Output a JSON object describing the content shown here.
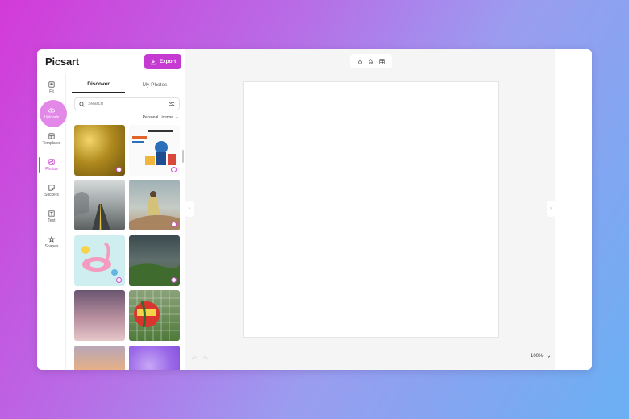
{
  "app": {
    "logo": "Picsart"
  },
  "header": {
    "export_label": "Export"
  },
  "rail": {
    "items": [
      {
        "label": "Fit",
        "icon": "fit-icon"
      },
      {
        "label": "Uploads",
        "icon": "upload-icon"
      },
      {
        "label": "Templates",
        "icon": "templates-icon"
      },
      {
        "label": "Photos",
        "icon": "photos-icon"
      },
      {
        "label": "Stickers",
        "icon": "stickers-icon"
      },
      {
        "label": "Text",
        "icon": "text-icon"
      },
      {
        "label": "Shapes",
        "icon": "shapes-icon"
      }
    ],
    "active": "Photos"
  },
  "panel": {
    "tabs": [
      {
        "label": "Discover"
      },
      {
        "label": "My Photos"
      }
    ],
    "search": {
      "placeholder": "Search",
      "value": ""
    },
    "license": "Personal License"
  },
  "photos": [
    {
      "subject": "gold glitter"
    },
    {
      "subject": "august sports poster"
    },
    {
      "subject": "foggy road"
    },
    {
      "subject": "woman on rock"
    },
    {
      "subject": "flamingo float"
    },
    {
      "subject": "stormy landscape"
    },
    {
      "subject": "pink sunset sky"
    },
    {
      "subject": "soccer ball in net"
    },
    {
      "subject": "beach sunset"
    },
    {
      "subject": "purple glitter"
    }
  ],
  "footer": {
    "zoom": "100%"
  },
  "colors": {
    "accent": "#c53ad0",
    "workspace": "#f5f5f6"
  }
}
